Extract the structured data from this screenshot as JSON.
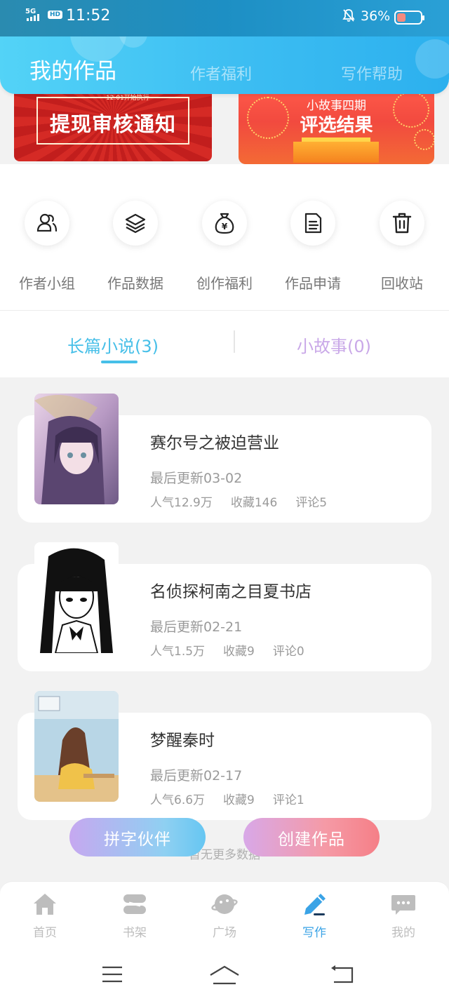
{
  "status_bar": {
    "network": "5G",
    "hd": "HD",
    "time": "11:52",
    "battery_pct": "36%",
    "battery_level": 0.36,
    "mute_icon": "bell-off-icon"
  },
  "header": {
    "title": "我的作品",
    "tabs": [
      "作者福利",
      "写作帮助"
    ]
  },
  "banners": {
    "left": {
      "tag": "12.01开始执行",
      "title": "提现审核通知"
    },
    "right": {
      "subtitle": "小故事四期",
      "title": "评选结果"
    }
  },
  "quick_actions": [
    {
      "label": "作者小组",
      "icon": "author-group-icon"
    },
    {
      "label": "作品数据",
      "icon": "layers-icon"
    },
    {
      "label": "创作福利",
      "icon": "money-bag-icon"
    },
    {
      "label": "作品申请",
      "icon": "document-icon"
    },
    {
      "label": "回收站",
      "icon": "trash-icon"
    }
  ],
  "work_tabs": {
    "active": "长篇小说(3)",
    "inactive": "小故事(0)"
  },
  "works": [
    {
      "title": "赛尔号之被迫营业",
      "updated": "最后更新03-02",
      "popularity": "人气12.9万",
      "favorites": "收藏146",
      "comments": "评论5"
    },
    {
      "title": "名侦探柯南之目夏书店",
      "updated": "最后更新02-21",
      "popularity": "人气1.5万",
      "favorites": "收藏9",
      "comments": "评论0"
    },
    {
      "title": "梦醒秦时",
      "updated": "最后更新02-17",
      "popularity": "人气6.6万",
      "favorites": "收藏9",
      "comments": "评论1"
    }
  ],
  "list_footer": "暂无更多数据",
  "fabs": {
    "left": "拼字伙伴",
    "right": "创建作品"
  },
  "bottom_nav": [
    {
      "label": "首页",
      "icon": "home-icon"
    },
    {
      "label": "书架",
      "icon": "bookshelf-icon"
    },
    {
      "label": "广场",
      "icon": "planet-icon"
    },
    {
      "label": "写作",
      "icon": "pen-icon",
      "active": true
    },
    {
      "label": "我的",
      "icon": "chat-bubble-icon"
    }
  ],
  "colors": {
    "header": "#3cbdf2",
    "accent": "#46bfe8",
    "tab_inactive": "#c9a8e8",
    "nav_active": "#3aa3e6"
  }
}
